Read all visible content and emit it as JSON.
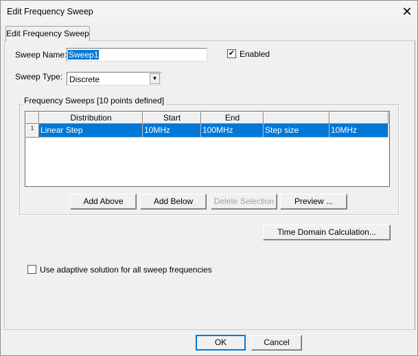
{
  "window": {
    "title": "Edit Frequency Sweep",
    "close": "✕"
  },
  "tab": {
    "label": "Edit Frequency Sweep"
  },
  "form": {
    "sweep_name_label": "Sweep Name:",
    "sweep_name_value": "Sweep1",
    "enabled_label": "Enabled",
    "enabled_checked": true,
    "check_glyph": "✔",
    "sweep_type_label": "Sweep Type:",
    "sweep_type_value": "Discrete"
  },
  "group": {
    "legend": "Frequency Sweeps [10 points defined]",
    "columns": [
      "Distribution",
      "Start",
      "End",
      "",
      ""
    ],
    "rows": [
      {
        "num": "1",
        "cells": [
          "Linear Step",
          "10MHz",
          "100MHz",
          "Step size",
          "10MHz"
        ]
      }
    ],
    "buttons": {
      "add_above": "Add Above",
      "add_below": "Add Below",
      "delete": "Delete Selection",
      "preview": "Preview ..."
    }
  },
  "time_domain": "Time Domain Calculation...",
  "adaptive_label": "Use adaptive solution for all sweep frequencies",
  "adaptive_checked": false,
  "footer": {
    "ok": "OK",
    "cancel": "Cancel"
  },
  "colors": {
    "selection": "#0078d7"
  }
}
